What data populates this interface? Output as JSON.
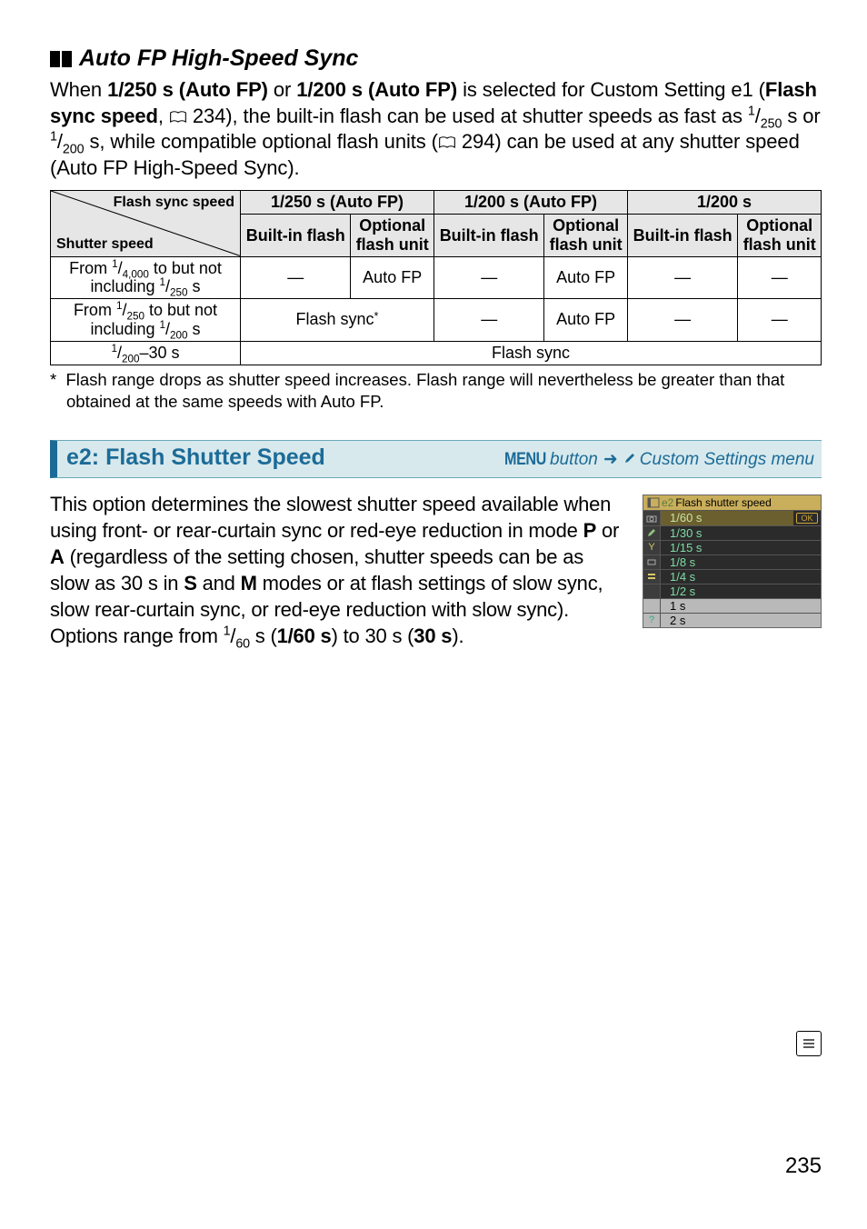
{
  "section1": {
    "title": "Auto FP High-Speed Sync",
    "para_parts": {
      "p1a": "When ",
      "p1b": "1/250 s (Auto FP)",
      "p1c": " or ",
      "p1d": "1/200 s (Auto FP)",
      "p1e": " is selected for Custom Setting e1 (",
      "p1f": "Flash sync speed",
      "p1g": ", ",
      "p1h": " 234), the built-in flash can be used at shutter speeds as fast as ",
      "p1i": " s or ",
      "p1j": " s, while compatible optional flash units (",
      "p1k": " 294) can be used at any shutter speed (Auto FP High-Speed Sync)."
    }
  },
  "table": {
    "corner_top": "Flash sync speed",
    "corner_bottom": "Shutter speed",
    "col_groups": [
      "1/250 s (Auto FP)",
      "1/200 s (Auto FP)",
      "1/200 s"
    ],
    "sub_builtin": "Built-in flash",
    "sub_optional_l1": "Optional",
    "sub_optional_l2": "flash unit",
    "row1_label_a": "From ",
    "row1_label_b": " to but not including ",
    "row1_label_c": " s",
    "row2_label_a": "From ",
    "row2_label_b": " to but not including ",
    "row2_label_c": " s",
    "row3_label": "–30 s",
    "dash": "—",
    "auto_fp": "Auto FP",
    "flash_sync_star": "Flash sync",
    "star": "*",
    "flash_sync": "Flash sync"
  },
  "footnote": {
    "star": "*",
    "text": "Flash range drops as shutter speed increases.  Flash range will nevertheless be greater than that obtained at the same speeds with Auto FP."
  },
  "e2": {
    "title": "e2: Flash Shutter Speed",
    "menu_word": "MENU",
    "button_word": " button",
    "custom_menu": "Custom Settings menu",
    "para_a": "This option determines the slowest shutter speed available when using front- or rear-curtain sync or red-eye reduction in mode ",
    "para_b": " or ",
    "para_c": " (regardless of the setting chosen, shutter speeds can be as slow as 30 s in ",
    "para_d": " and ",
    "para_e": " modes or at flash settings of slow sync, slow rear-curtain sync, or red-eye reduction with slow sync).  Options range from ",
    "para_f": " s (",
    "para_g": "1/60 s",
    "para_h": ") to 30 s (",
    "para_i": "30 s",
    "para_j": ")."
  },
  "mode_letters": {
    "P": "P",
    "A": "A",
    "S": "S",
    "M": "M"
  },
  "cam": {
    "header_tag": "e2",
    "header_text": "Flash shutter speed",
    "rows": [
      "1/60 s",
      "1/30 s",
      "1/15 s",
      "1/8 s",
      "1/4 s",
      "1/2 s",
      "1 s",
      "2 s"
    ],
    "ok": "OK"
  },
  "page_num": "235"
}
